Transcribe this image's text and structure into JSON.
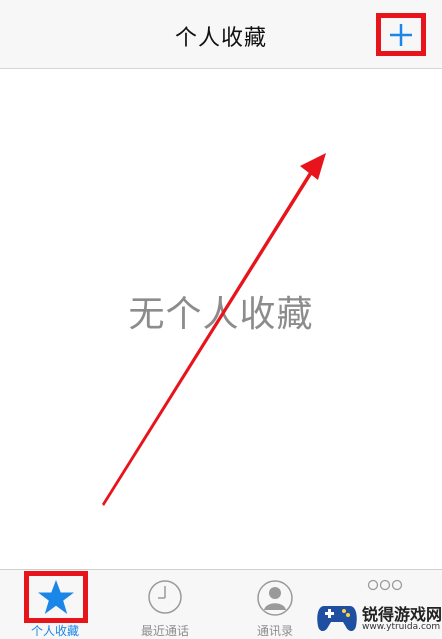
{
  "navbar": {
    "title": "个人收藏"
  },
  "main": {
    "empty_text": "无个人收藏"
  },
  "tabbar": {
    "tabs": [
      {
        "label": "个人收藏",
        "icon": "star-icon",
        "active": true
      },
      {
        "label": "最近通话",
        "icon": "clock-icon",
        "active": false
      },
      {
        "label": "通讯录",
        "icon": "contacts-icon",
        "active": false
      },
      {
        "label": "",
        "icon": "keypad-icon",
        "active": false
      }
    ]
  },
  "watermark": {
    "name": "锐得游戏网",
    "url": "www.ytruida.com"
  },
  "colors": {
    "accent": "#1a86e8",
    "annotation_red": "#e8141b",
    "empty_text": "#8c8c8c",
    "bar_background": "#f7f7f7"
  }
}
